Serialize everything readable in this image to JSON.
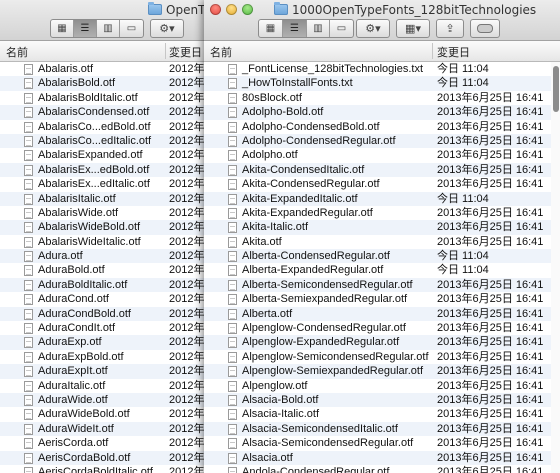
{
  "back_window": {
    "title": "OpenTy",
    "header": {
      "name_col": "名前",
      "date_col": "変更日"
    },
    "files": [
      {
        "name": "Abalaris.otf",
        "date": "2012年"
      },
      {
        "name": "AbalarisBold.otf",
        "date": "2012年"
      },
      {
        "name": "AbalarisBoldItalic.otf",
        "date": "2012年"
      },
      {
        "name": "AbalarisCondensed.otf",
        "date": "2012年"
      },
      {
        "name": "AbalarisCo...edBold.otf",
        "date": "2012年"
      },
      {
        "name": "AbalarisCo...edItalic.otf",
        "date": "2012年"
      },
      {
        "name": "AbalarisExpanded.otf",
        "date": "2012年"
      },
      {
        "name": "AbalarisEx...edBold.otf",
        "date": "2012年"
      },
      {
        "name": "AbalarisEx...edItalic.otf",
        "date": "2012年"
      },
      {
        "name": "AbalarisItalic.otf",
        "date": "2012年"
      },
      {
        "name": "AbalarisWide.otf",
        "date": "2012年"
      },
      {
        "name": "AbalarisWideBold.otf",
        "date": "2012年"
      },
      {
        "name": "AbalarisWideItalic.otf",
        "date": "2012年"
      },
      {
        "name": "Adura.otf",
        "date": "2012年"
      },
      {
        "name": "AduraBold.otf",
        "date": "2012年"
      },
      {
        "name": "AduraBoldItalic.otf",
        "date": "2012年"
      },
      {
        "name": "AduraCond.otf",
        "date": "2012年"
      },
      {
        "name": "AduraCondBold.otf",
        "date": "2012年"
      },
      {
        "name": "AduraCondIt.otf",
        "date": "2012年"
      },
      {
        "name": "AduraExp.otf",
        "date": "2012年"
      },
      {
        "name": "AduraExpBold.otf",
        "date": "2012年"
      },
      {
        "name": "AduraExpIt.otf",
        "date": "2012年"
      },
      {
        "name": "AduraItalic.otf",
        "date": "2012年"
      },
      {
        "name": "AduraWide.otf",
        "date": "2012年"
      },
      {
        "name": "AduraWideBold.otf",
        "date": "2012年"
      },
      {
        "name": "AduraWideIt.otf",
        "date": "2012年"
      },
      {
        "name": "AerisCorda.otf",
        "date": "2012年"
      },
      {
        "name": "AerisCordaBold.otf",
        "date": "2012年"
      },
      {
        "name": "AerisCordaBoldItalic.otf",
        "date": "2012年"
      }
    ]
  },
  "front_window": {
    "title": "1000OpenTypeFonts_128bitTechnologies",
    "header": {
      "name_col": "名前",
      "date_col": "変更日"
    },
    "files": [
      {
        "name": "_FontLicense_128bitTechnologies.txt",
        "date": "今日 11:04"
      },
      {
        "name": "_HowToInstallFonts.txt",
        "date": "今日 11:04"
      },
      {
        "name": "80sBlock.otf",
        "date": "2013年6月25日 16:41"
      },
      {
        "name": "Adolpho-Bold.otf",
        "date": "2013年6月25日 16:41"
      },
      {
        "name": "Adolpho-CondensedBold.otf",
        "date": "2013年6月25日 16:41"
      },
      {
        "name": "Adolpho-CondensedRegular.otf",
        "date": "2013年6月25日 16:41"
      },
      {
        "name": "Adolpho.otf",
        "date": "2013年6月25日 16:41"
      },
      {
        "name": "Akita-CondensedItalic.otf",
        "date": "2013年6月25日 16:41"
      },
      {
        "name": "Akita-CondensedRegular.otf",
        "date": "2013年6月25日 16:41"
      },
      {
        "name": "Akita-ExpandedItalic.otf",
        "date": "今日 11:04"
      },
      {
        "name": "Akita-ExpandedRegular.otf",
        "date": "2013年6月25日 16:41"
      },
      {
        "name": "Akita-Italic.otf",
        "date": "2013年6月25日 16:41"
      },
      {
        "name": "Akita.otf",
        "date": "2013年6月25日 16:41"
      },
      {
        "name": "Alberta-CondensedRegular.otf",
        "date": "今日 11:04"
      },
      {
        "name": "Alberta-ExpandedRegular.otf",
        "date": "今日 11:04"
      },
      {
        "name": "Alberta-SemicondensedRegular.otf",
        "date": "2013年6月25日 16:41"
      },
      {
        "name": "Alberta-SemiexpandedRegular.otf",
        "date": "2013年6月25日 16:41"
      },
      {
        "name": "Alberta.otf",
        "date": "2013年6月25日 16:41"
      },
      {
        "name": "Alpenglow-CondensedRegular.otf",
        "date": "2013年6月25日 16:41"
      },
      {
        "name": "Alpenglow-ExpandedRegular.otf",
        "date": "2013年6月25日 16:41"
      },
      {
        "name": "Alpenglow-SemicondensedRegular.otf",
        "date": "2013年6月25日 16:41"
      },
      {
        "name": "Alpenglow-SemiexpandedRegular.otf",
        "date": "2013年6月25日 16:41"
      },
      {
        "name": "Alpenglow.otf",
        "date": "2013年6月25日 16:41"
      },
      {
        "name": "Alsacia-Bold.otf",
        "date": "2013年6月25日 16:41"
      },
      {
        "name": "Alsacia-Italic.otf",
        "date": "2013年6月25日 16:41"
      },
      {
        "name": "Alsacia-SemicondensedItalic.otf",
        "date": "2013年6月25日 16:41"
      },
      {
        "name": "Alsacia-SemicondensedRegular.otf",
        "date": "2013年6月25日 16:41"
      },
      {
        "name": "Alsacia.otf",
        "date": "2013年6月25日 16:41"
      },
      {
        "name": "Andola-CondensedRegular.otf",
        "date": "2013年6月25日 16:41"
      }
    ]
  },
  "toolbar": {
    "view_icons": [
      "icon-view-icon",
      "list-view-icon",
      "column-view-icon",
      "coverflow-view-icon"
    ],
    "action_glyph": "⚙",
    "arrange_glyph": "▦",
    "share_glyph": "⇪",
    "dropdown_glyph": "▾"
  }
}
